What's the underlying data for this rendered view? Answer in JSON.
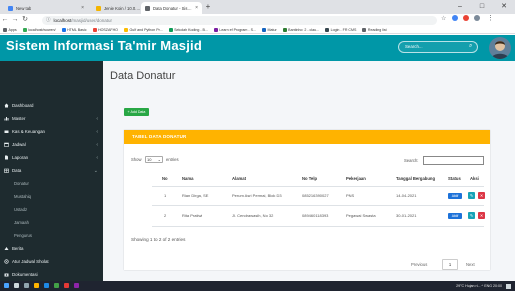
{
  "browser": {
    "tabs": [
      {
        "title": "New tab",
        "fav_color": "#4285f4"
      },
      {
        "title": "Jenie Koin / 10.0.0.1 / masjid ( 7 )",
        "fav_color": "#f4b400"
      },
      {
        "title": "Data Donatur - Sistem Informasi",
        "fav_color": "#5f6368"
      }
    ],
    "new_tab": "+",
    "window_controls": {
      "minimize": "–",
      "maximize": "□",
      "close": "✕"
    },
    "url_host": "localhost",
    "url_path": "/masjid/user/donatur",
    "bookmarks": [
      {
        "label": "Apps",
        "color": "#5f6368"
      },
      {
        "label": "localhost/wowen/",
        "color": "#34a853"
      },
      {
        "label": "HTML Basic",
        "color": "#1a73e8"
      },
      {
        "label": "HOSZAFHO",
        "color": "#ea4335"
      },
      {
        "label": "Gulf and Python Pr...",
        "color": "#fbbc04"
      },
      {
        "label": "Sekolah Koding - B...",
        "color": "#0f9d58"
      },
      {
        "label": "Learn ef Program - S...",
        "color": "#7b1fa2"
      },
      {
        "label": "Matur",
        "color": "#1565c0"
      },
      {
        "label": "Bantinho: 2 - clau...",
        "color": "#2e7d32"
      },
      {
        "label": "Login - FR CMS",
        "color": "#37474f"
      },
      {
        "label": "Reading list",
        "color": "#5f6368"
      }
    ]
  },
  "app": {
    "title": "Sistem Informasi Ta'mir Masjid",
    "search_placeholder": "Search..."
  },
  "sidebar": {
    "items": [
      {
        "label": "Dashboard",
        "icon": "home-icon",
        "chevron": false
      },
      {
        "label": "Master",
        "icon": "chart-icon",
        "chevron": true
      },
      {
        "label": "Kas & Keuangan",
        "icon": "money-icon",
        "chevron": true
      },
      {
        "label": "Jadwal",
        "icon": "calendar-icon",
        "chevron": true
      },
      {
        "label": "Laporan",
        "icon": "file-icon",
        "chevron": true
      },
      {
        "label": "Data",
        "icon": "table-icon",
        "chevron": true
      }
    ],
    "subitems": [
      "Donatur",
      "Mustahiq",
      "Ustadz",
      "Jamaah",
      "Pengurus"
    ],
    "bottom_items": [
      {
        "label": "Berita",
        "icon": "news-icon"
      },
      {
        "label": "Atur Jadwal Sholat",
        "icon": "settings-icon"
      },
      {
        "label": "Dokumentasi",
        "icon": "camera-icon"
      }
    ]
  },
  "main": {
    "page_title": "Data Donatur",
    "add_button": "+ Add Data",
    "card_title": "TABEL DATA DONATUR",
    "show_label": "Show",
    "entries_value": "10",
    "entries_label": "entries",
    "search_label": "Search:",
    "columns": [
      "No",
      "Nama",
      "Alamat",
      "No Telp",
      "Pekerjaan",
      "Tanggal Bergabung",
      "Status",
      "Aksi"
    ],
    "rows": [
      {
        "no": "1",
        "nama": "Rian Dirga, SE",
        "alamat": "Perum Asri Permai, Blok D3",
        "telp": "085216390027",
        "pekerjaan": "PNS",
        "tanggal": "14-04-2021",
        "status": "Aktif"
      },
      {
        "no": "2",
        "nama": "Rita Pratiwi",
        "alamat": "Jl. Cendrawasih, No 32",
        "telp": "089460118393",
        "pekerjaan": "Pegawai Swasta",
        "tanggal": "30-01-2021",
        "status": "Aktif"
      }
    ],
    "info_text": "Showing 1 to 2 of 2 entries",
    "pagination": {
      "prev": "Previous",
      "page": "1",
      "next": "Next"
    }
  },
  "taskbar": {
    "tray_text": "29°C  Hujan ri...  ^  ENG  20:00"
  }
}
